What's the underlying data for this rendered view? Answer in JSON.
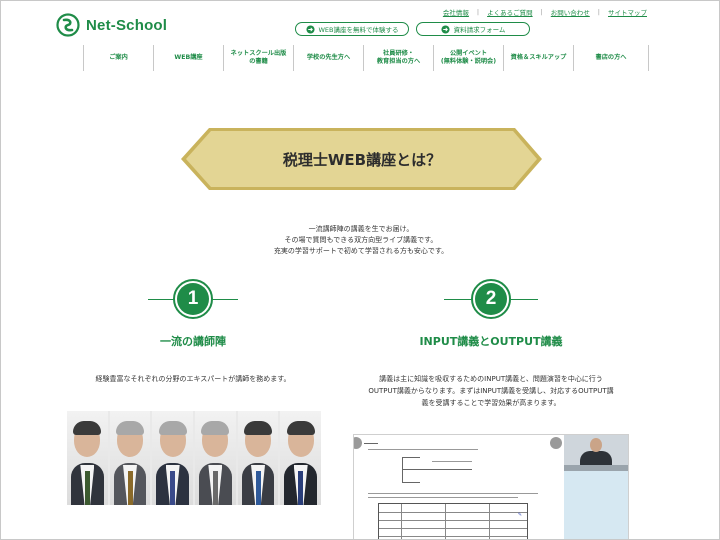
{
  "header": {
    "logo_text": "Net-School",
    "top_links": [
      "会社情報",
      "よくあるご質問",
      "お問い合わせ",
      "サイトマップ"
    ],
    "cta_buttons": [
      "WEB講座を無料で体験する",
      "資料請求フォーム"
    ]
  },
  "nav": {
    "items": [
      {
        "label": "ご案内",
        "width": 70
      },
      {
        "label": "WEB講座",
        "width": 70
      },
      {
        "label": "ネットスクール出版\nの書籍",
        "width": 70
      },
      {
        "label": "学校の先生方へ",
        "width": 70
      },
      {
        "label": "社員研修・\n教育担当の方へ",
        "width": 70
      },
      {
        "label": "公開イベント\n(無料体験・説明会)",
        "width": 70
      },
      {
        "label": "資格＆スキルアップ",
        "width": 70
      },
      {
        "label": "書店の方へ",
        "width": 75
      }
    ]
  },
  "banner": {
    "title": "税理士WEB講座とは？"
  },
  "intro": {
    "lines": [
      "一流講師陣の講義を生でお届け。",
      "その場で質問もできる双方向型ライブ講義です。",
      "充実の学習サポートで初めて学習される方も安心です。"
    ]
  },
  "features": [
    {
      "number": "1",
      "title": "一流の講師陣",
      "desc": [
        "経験豊富なそれぞれの分野のエキスパートが講師を務めます。"
      ]
    },
    {
      "number": "2",
      "title": "INPUT講義とOUTPUT講義",
      "desc": [
        "講義は主に知識を吸収するためのINPUT講義と、問題演習を中心に行う",
        "OUTPUT講義からなります。まずはINPUT講義を受講し、対応するOUTPUT講",
        "義を受講することで学習効果が高まります。"
      ]
    }
  ],
  "colors": {
    "brand_green": "#1f8c48",
    "banner_fill": "#e3d594",
    "banner_border": "#c9b35c"
  },
  "icons": {
    "logo": "net-school-logo-icon",
    "cta_arrow": "arrow-right-circle-icon"
  }
}
